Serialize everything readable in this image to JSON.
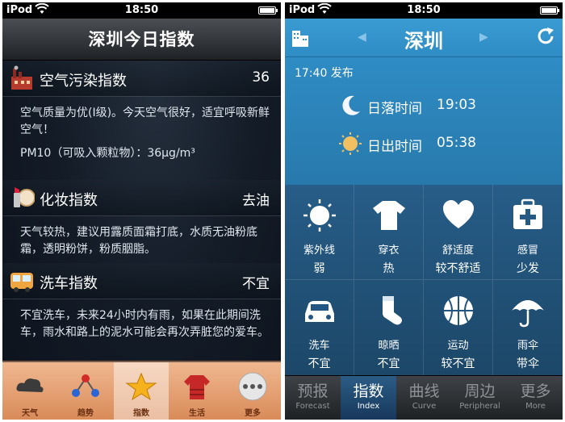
{
  "left": {
    "status": {
      "carrier": "iPod",
      "time": "18:50"
    },
    "title": "深圳今日指数",
    "cards": [
      {
        "name": "空气污染指数",
        "value": "36",
        "desc": [
          "空气质量为优(I级)。今天空气很好，适宜呼吸新鲜空气！",
          "PM10（可吸入颗粒物）：36μg/m³"
        ]
      },
      {
        "name": "化妆指数",
        "value": "去油",
        "desc": [
          "天气较热，建议用露质面霜打底，水质无油粉底霜，透明粉饼，粉质胭脂。"
        ]
      },
      {
        "name": "洗车指数",
        "value": "不宜",
        "desc": [
          "不宜洗车，未来24小时内有雨，如果在此期间洗车，雨水和路上的泥水可能会再次弄脏您的爱车。"
        ]
      }
    ],
    "tabs": [
      {
        "label": "天气"
      },
      {
        "label": "趋势"
      },
      {
        "label": "指数"
      },
      {
        "label": "生活"
      },
      {
        "label": "更多"
      }
    ]
  },
  "right": {
    "status": {
      "carrier": "iPod",
      "time": "18:50"
    },
    "city": "深圳",
    "published": "17:40 发布",
    "sunset": {
      "label": "日落时间",
      "time": "19:03"
    },
    "sunrise": {
      "label": "日出时间",
      "time": "05:38"
    },
    "indices": [
      {
        "name": "紫外线",
        "value": "弱",
        "icon": "sun-icon"
      },
      {
        "name": "穿衣",
        "value": "热",
        "icon": "tshirt-icon"
      },
      {
        "name": "舒适度",
        "value": "较不舒适",
        "icon": "heart-icon"
      },
      {
        "name": "感冒",
        "value": "少发",
        "icon": "medkit-icon"
      },
      {
        "name": "洗车",
        "value": "不宜",
        "icon": "car-icon"
      },
      {
        "name": "晾晒",
        "value": "不宜",
        "icon": "sock-icon"
      },
      {
        "name": "运动",
        "value": "较不宜",
        "icon": "ball-icon"
      },
      {
        "name": "雨伞",
        "value": "带伞",
        "icon": "umbrella-icon"
      }
    ],
    "tabs": [
      {
        "zh": "预报",
        "en": "Forecast"
      },
      {
        "zh": "指数",
        "en": "Index"
      },
      {
        "zh": "曲线",
        "en": "Curve"
      },
      {
        "zh": "周边",
        "en": "Peripheral"
      },
      {
        "zh": "更多",
        "en": "More"
      }
    ]
  }
}
